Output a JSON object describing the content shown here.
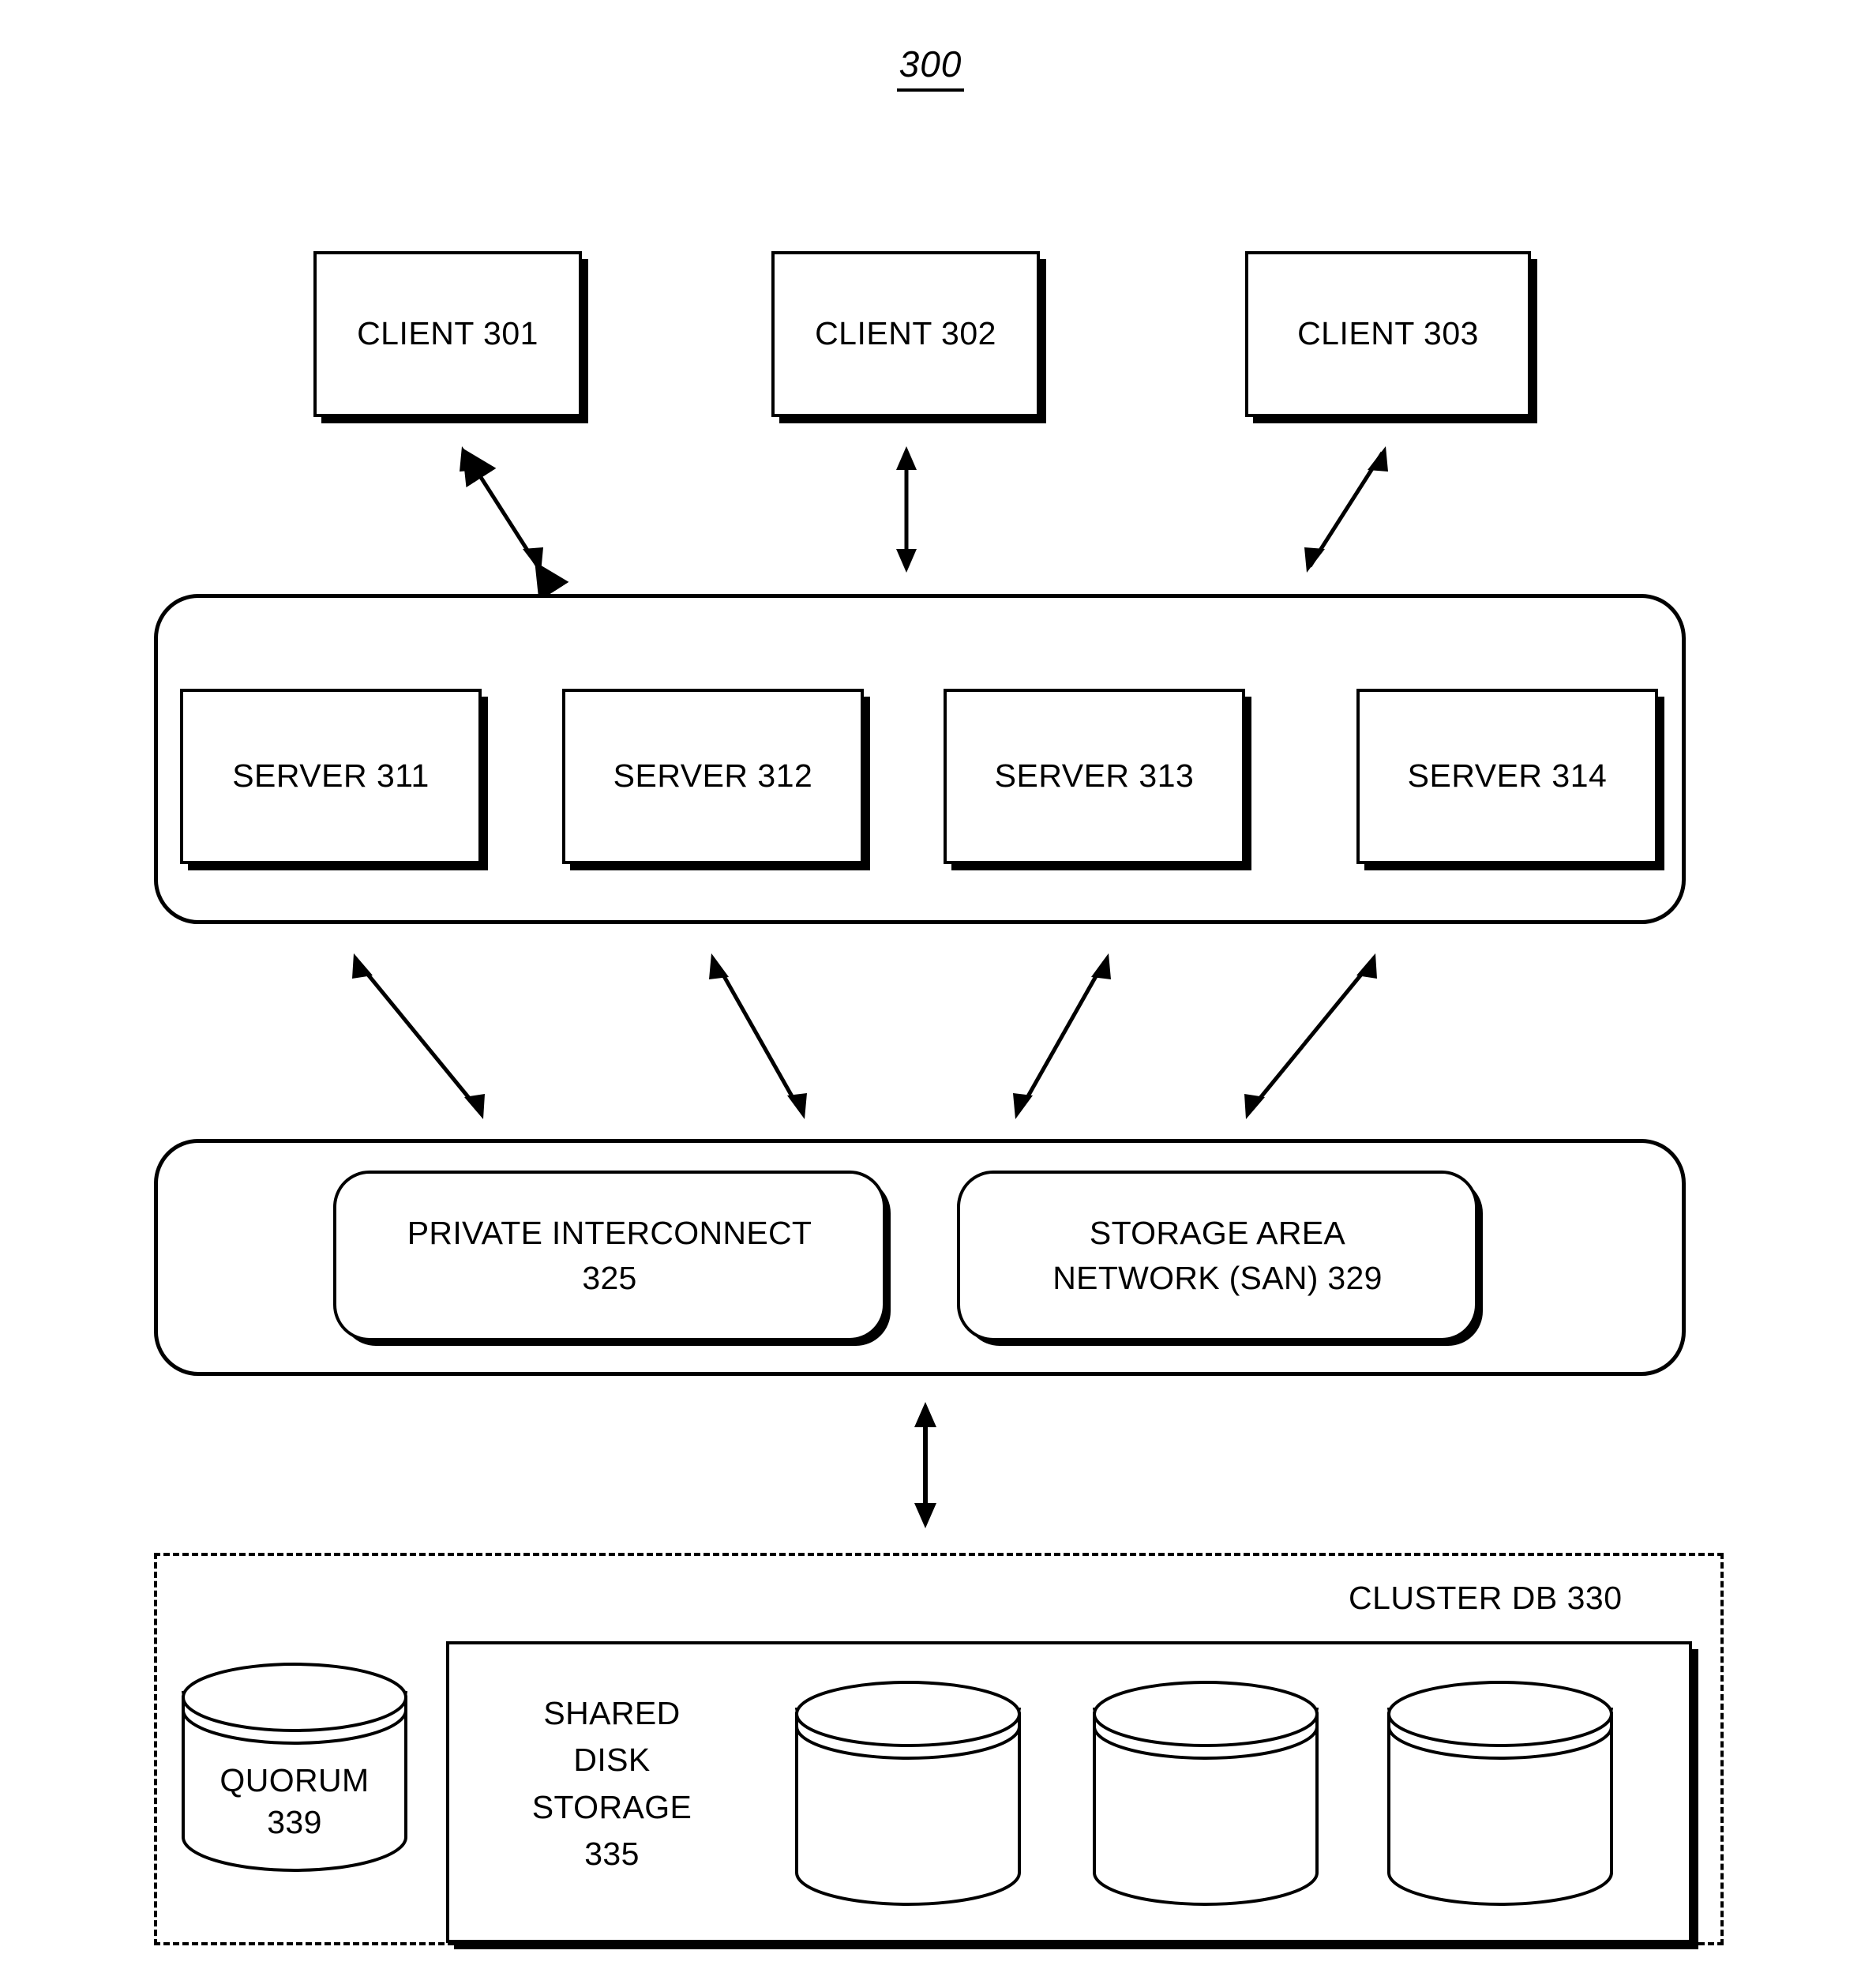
{
  "figure": {
    "number": "300"
  },
  "clients": [
    {
      "label": "CLIENT 301"
    },
    {
      "label": "CLIENT 302"
    },
    {
      "label": "CLIENT 303"
    }
  ],
  "servers": [
    {
      "label": "SERVER 311"
    },
    {
      "label": "SERVER 312"
    },
    {
      "label": "SERVER 313"
    },
    {
      "label": "SERVER 314"
    }
  ],
  "network": {
    "interconnect": "PRIVATE INTERCONNECT\n325",
    "san": "STORAGE AREA\nNETWORK (SAN) 329"
  },
  "cluster_db": {
    "label": "CLUSTER DB 330",
    "quorum": "QUORUM\n339",
    "shared_disk_storage": "SHARED\nDISK\nSTORAGE\n335",
    "disks": [
      {
        "name": "disk-cylinder-1"
      },
      {
        "name": "disk-cylinder-2"
      },
      {
        "name": "disk-cylinder-3"
      }
    ]
  },
  "connections": {
    "client_to_server": [
      {
        "name": "client-301-server-link"
      },
      {
        "name": "client-302-server-link"
      },
      {
        "name": "client-303-server-link"
      }
    ],
    "server_to_network": [
      {
        "name": "server-311-network-link"
      },
      {
        "name": "server-312-network-link"
      },
      {
        "name": "server-313-network-link"
      },
      {
        "name": "server-314-network-link"
      }
    ],
    "network_to_clusterdb": [
      {
        "name": "network-clusterdb-link"
      }
    ]
  },
  "colors": {
    "stroke": "#000000",
    "background": "#ffffff"
  }
}
